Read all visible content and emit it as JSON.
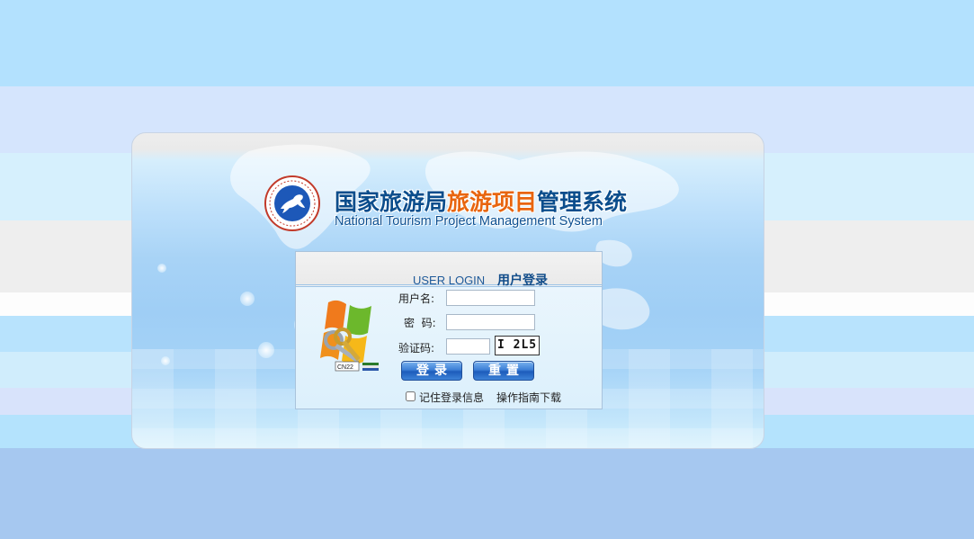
{
  "header": {
    "title_cn_prefix": "国家旅游局",
    "title_cn_highlight": "旅游项目",
    "title_cn_suffix": "管理系统",
    "title_en": "National Tourism Project Management System"
  },
  "login": {
    "heading_en": "USER LOGIN",
    "heading_cn": "用户登录",
    "username_label": "用户名:",
    "username_value": "",
    "password_label": "密  码:",
    "password_value": "",
    "captcha_label": "验证码:",
    "captcha_value": "",
    "captcha_image_text": "I 2L5",
    "login_button": "登录",
    "reset_button": "重置",
    "remember_label": "记住登录信息",
    "remember_checked": false,
    "guide_link": "操作指南下载",
    "keys_badge": "CN22"
  },
  "colors": {
    "title_blue": "#0b4d8c",
    "title_orange": "#e8650f",
    "button_blue": "#1d5cbb"
  },
  "icons": [
    "horse-emblem-icon",
    "windows-keys-icon"
  ]
}
